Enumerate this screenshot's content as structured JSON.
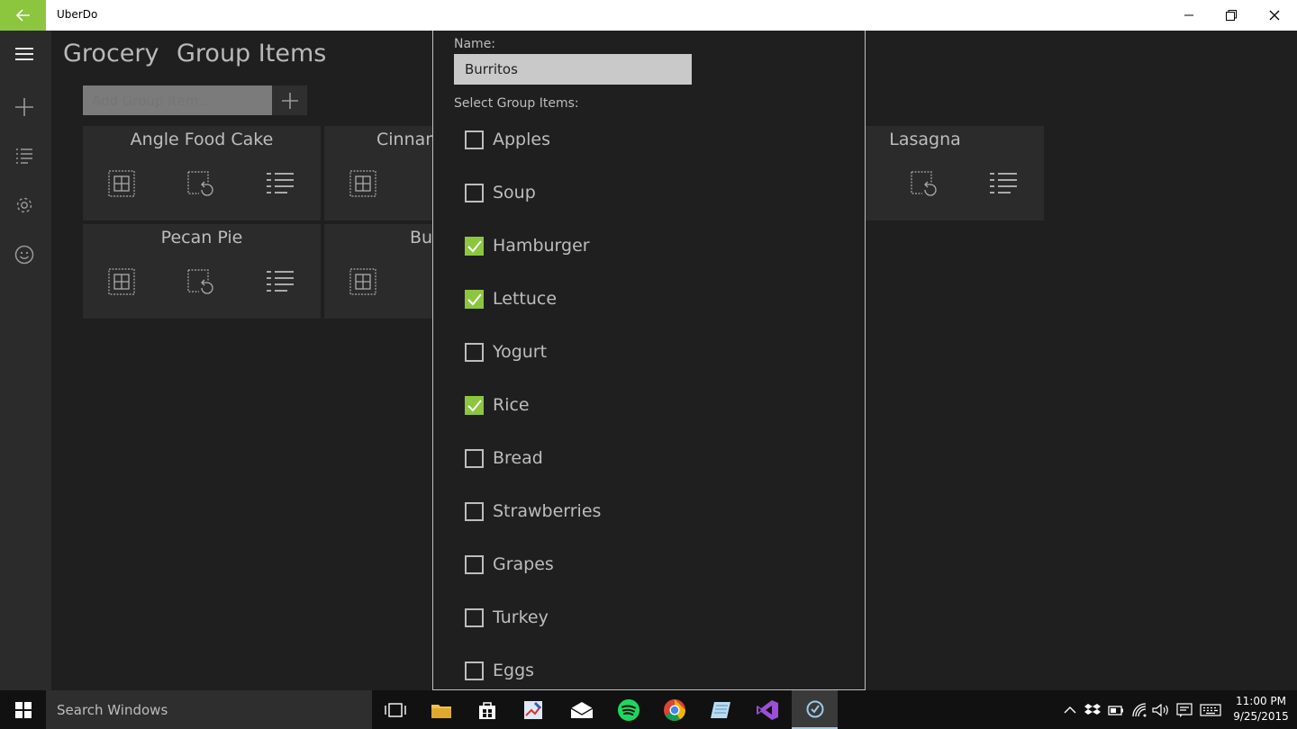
{
  "window": {
    "app_title": "UberDo",
    "icons": {
      "back": "back-arrow-icon",
      "minimize": "minimize-icon",
      "restore": "restore-icon",
      "close": "close-icon"
    },
    "accent_color": "#8cc63f"
  },
  "nav_rail": {
    "items": [
      "hamburger-menu-icon",
      "add-icon",
      "list-icon",
      "settings-gear-icon",
      "smiley-icon"
    ]
  },
  "header": {
    "title": "Grocery",
    "subtitle": "Group Items"
  },
  "add_group_item": {
    "placeholder": "Add Group Item...",
    "button_icon": "plus-icon"
  },
  "tiles": [
    {
      "title": "Angle Food Cake"
    },
    {
      "title": "Cinnan"
    },
    {
      "title": "Lasagna"
    },
    {
      "title": "Pecan Pie"
    },
    {
      "title": "Bu"
    }
  ],
  "tile_icons": [
    "grid-icon",
    "undo-selection-icon",
    "list-icon"
  ],
  "dialog": {
    "name_label": "Name:",
    "name_value": "Burritos",
    "select_label": "Select Group Items:",
    "items": [
      {
        "label": "Apples",
        "checked": false
      },
      {
        "label": "Soup",
        "checked": false
      },
      {
        "label": "Hamburger",
        "checked": true
      },
      {
        "label": "Lettuce",
        "checked": true
      },
      {
        "label": "Yogurt",
        "checked": false
      },
      {
        "label": "Rice",
        "checked": true
      },
      {
        "label": "Bread",
        "checked": false
      },
      {
        "label": "Strawberries",
        "checked": false
      },
      {
        "label": "Grapes",
        "checked": false
      },
      {
        "label": "Turkey",
        "checked": false
      },
      {
        "label": "Eggs",
        "checked": false
      }
    ]
  },
  "taskbar": {
    "search_placeholder": "Search Windows",
    "apps": [
      "task-view-icon",
      "file-explorer-icon",
      "store-icon",
      "paint-icon",
      "mail-icon",
      "spotify-icon",
      "chrome-icon",
      "notepad-icon",
      "visual-studio-icon",
      "uberdo-icon"
    ],
    "tray": [
      "chevron-up-icon",
      "dropbox-icon",
      "battery-icon",
      "wifi-icon",
      "volume-icon",
      "notifications-icon",
      "keyboard-icon"
    ],
    "time": "11:00 PM",
    "date": "9/25/2015"
  }
}
